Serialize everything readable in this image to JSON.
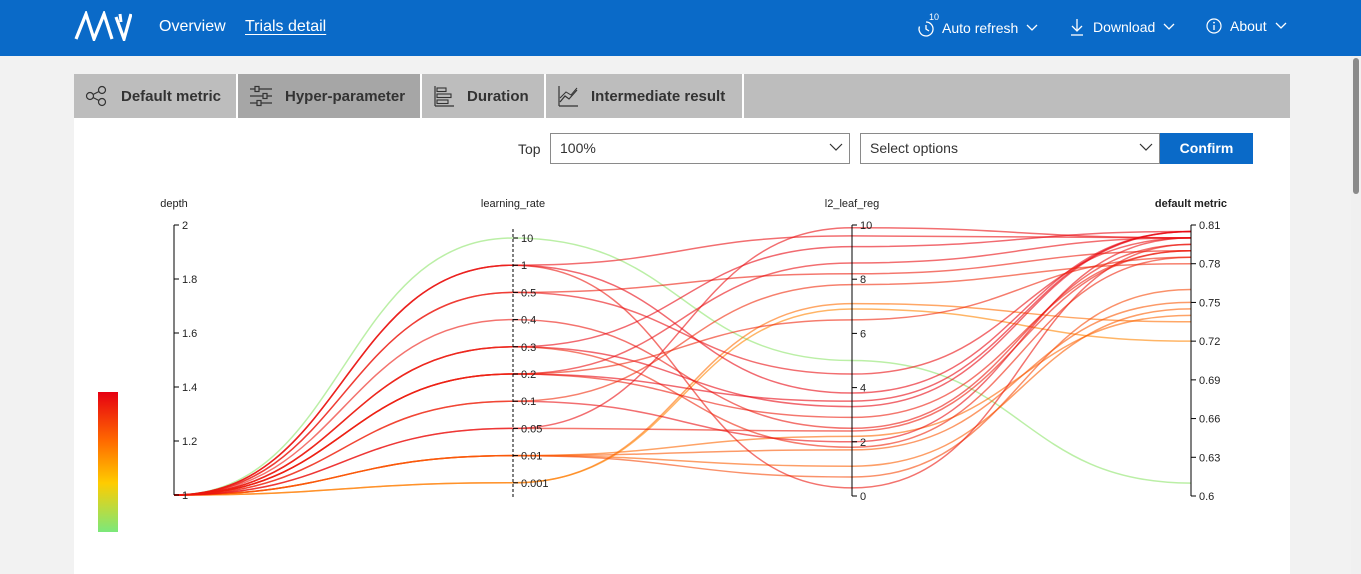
{
  "nav": {
    "overview_label": "Overview",
    "trials_detail_label": "Trials detail",
    "auto_refresh_label": "Auto refresh",
    "auto_refresh_badge": "10",
    "download_label": "Download",
    "about_label": "About"
  },
  "tabs": [
    {
      "label": "Default metric",
      "icon": "scatter-icon"
    },
    {
      "label": "Hyper-parameter",
      "icon": "sliders-icon"
    },
    {
      "label": "Duration",
      "icon": "bar-chart-icon"
    },
    {
      "label": "Intermediate result",
      "icon": "line-chart-icon"
    }
  ],
  "filter": {
    "top_label": "Top",
    "top_value": "100%",
    "options_placeholder": "Select options",
    "confirm_label": "Confirm"
  },
  "colors": {
    "brand": "#0a6ac8",
    "scale_high": "#e60012",
    "scale_mid": "#ffcc00",
    "scale_low": "#7be87b"
  },
  "chart_data": {
    "type": "parallel_coordinates",
    "dimensions": [
      {
        "name": "depth",
        "scale": "linear",
        "ticks": [
          "2",
          "1.8",
          "1.6",
          "1.4",
          "1.2",
          "1"
        ]
      },
      {
        "name": "learning_rate",
        "scale": "categorical",
        "ticks": [
          "10",
          "1",
          "0.5",
          "0.4",
          "0.3",
          "0.2",
          "0.1",
          "0.05",
          "0.01",
          "0.001"
        ]
      },
      {
        "name": "l2_leaf_reg",
        "scale": "linear",
        "ticks": [
          "10",
          "8",
          "6",
          "4",
          "2",
          "0"
        ]
      },
      {
        "name": "default metric",
        "scale": "linear",
        "ticks": [
          "0.81",
          "0.78",
          "0.75",
          "0.72",
          "0.69",
          "0.66",
          "0.63",
          "0.6"
        ]
      }
    ],
    "color_scale": "default metric",
    "trials": [
      {
        "depth": 1,
        "learning_rate": "10",
        "l2_leaf_reg": 5,
        "metric": 0.61
      },
      {
        "depth": 1,
        "learning_rate": "0.001",
        "l2_leaf_reg": 7.1,
        "metric": 0.735
      },
      {
        "depth": 1,
        "learning_rate": "0.001",
        "l2_leaf_reg": 6.9,
        "metric": 0.72
      },
      {
        "depth": 1,
        "learning_rate": "0.01",
        "l2_leaf_reg": 2.2,
        "metric": 0.74
      },
      {
        "depth": 1,
        "learning_rate": "0.01",
        "l2_leaf_reg": 1.1,
        "metric": 0.745
      },
      {
        "depth": 1,
        "learning_rate": "0.01",
        "l2_leaf_reg": 0.7,
        "metric": 0.76
      },
      {
        "depth": 1,
        "learning_rate": "0.01",
        "l2_leaf_reg": 1.7,
        "metric": 0.75
      },
      {
        "depth": 1,
        "learning_rate": "1",
        "l2_leaf_reg": 3.8,
        "metric": 0.805
      },
      {
        "depth": 1,
        "learning_rate": "1",
        "l2_leaf_reg": 9.6,
        "metric": 0.8
      },
      {
        "depth": 1,
        "learning_rate": "1",
        "l2_leaf_reg": 0.3,
        "metric": 0.795
      },
      {
        "depth": 1,
        "learning_rate": "0.5",
        "l2_leaf_reg": 4.5,
        "metric": 0.8
      },
      {
        "depth": 1,
        "learning_rate": "0.5",
        "l2_leaf_reg": 8.2,
        "metric": 0.79
      },
      {
        "depth": 1,
        "learning_rate": "0.4",
        "l2_leaf_reg": 2.5,
        "metric": 0.795
      },
      {
        "depth": 1,
        "learning_rate": "0.3",
        "l2_leaf_reg": 3.3,
        "metric": 0.805
      },
      {
        "depth": 1,
        "learning_rate": "0.3",
        "l2_leaf_reg": 9.2,
        "metric": 0.805
      },
      {
        "depth": 1,
        "learning_rate": "0.3",
        "l2_leaf_reg": 1.8,
        "metric": 0.785
      },
      {
        "depth": 1,
        "learning_rate": "0.2",
        "l2_leaf_reg": 3.5,
        "metric": 0.805
      },
      {
        "depth": 1,
        "learning_rate": "0.2",
        "l2_leaf_reg": 8.6,
        "metric": 0.8
      },
      {
        "depth": 1,
        "learning_rate": "0.2",
        "l2_leaf_reg": 6.5,
        "metric": 0.785
      },
      {
        "depth": 1,
        "learning_rate": "0.2",
        "l2_leaf_reg": 2.9,
        "metric": 0.79
      },
      {
        "depth": 1,
        "learning_rate": "0.1",
        "l2_leaf_reg": 2.0,
        "metric": 0.8
      },
      {
        "depth": 1,
        "learning_rate": "0.1",
        "l2_leaf_reg": 7.8,
        "metric": 0.78
      },
      {
        "depth": 1,
        "learning_rate": "0.05",
        "l2_leaf_reg": 2.4,
        "metric": 0.79
      },
      {
        "depth": 1,
        "learning_rate": "0.05",
        "l2_leaf_reg": 9.9,
        "metric": 0.8
      }
    ]
  }
}
